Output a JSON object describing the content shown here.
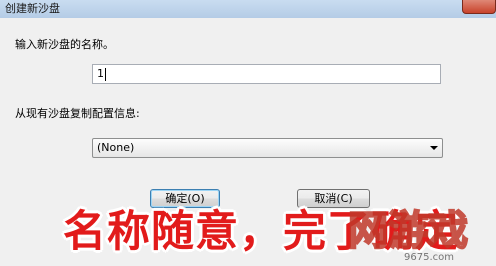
{
  "window": {
    "title": "创建新沙盘"
  },
  "form": {
    "name_label": "输入新沙盘的名称。",
    "name_value": "1",
    "copy_label": "从现有沙盘复制配置信息:",
    "copy_selected": "(None)"
  },
  "buttons": {
    "ok_label": "确定(O)",
    "cancel_label": "取消(C)"
  },
  "overlay": {
    "caption": "名称随意，完了确定",
    "watermark_text": "网游戏",
    "watermark_sub": "9675.com"
  },
  "colors": {
    "caption": "#e21b1b",
    "watermark": "#c0392b"
  }
}
